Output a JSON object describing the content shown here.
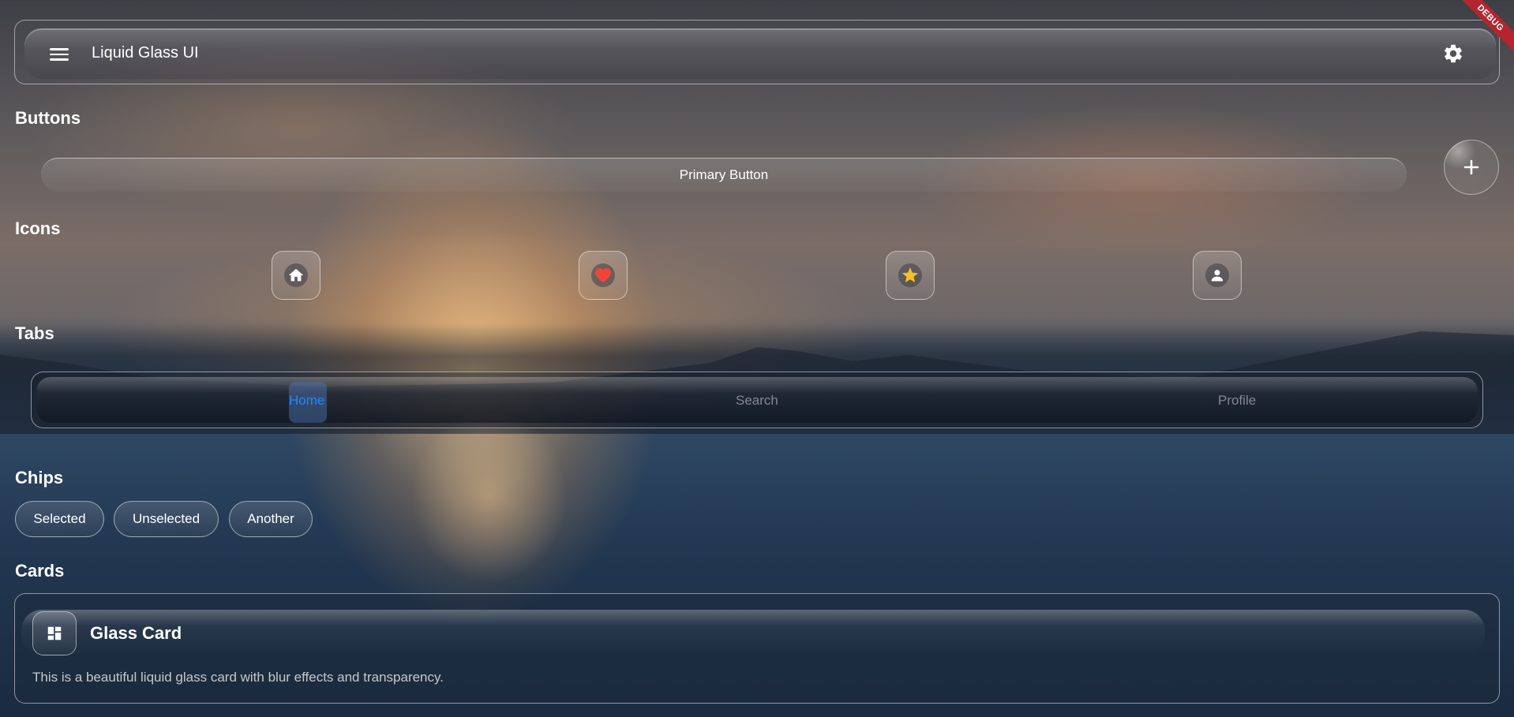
{
  "app_bar": {
    "title": "Liquid Glass UI",
    "menu_icon": "menu-icon",
    "settings_icon": "gear-icon"
  },
  "debug_banner": "DEBUG",
  "sections": {
    "buttons": "Buttons",
    "icons": "Icons",
    "tabs": "Tabs",
    "chips": "Chips",
    "cards": "Cards"
  },
  "buttons": {
    "primary_label": "Primary Button",
    "fab_icon": "plus-icon"
  },
  "icons": [
    {
      "name": "home-icon",
      "color": "#ffffff"
    },
    {
      "name": "heart-icon",
      "color": "#f04438"
    },
    {
      "name": "star-icon",
      "color": "#f6c026"
    },
    {
      "name": "person-icon",
      "color": "#ffffff"
    }
  ],
  "tabs": {
    "items": [
      {
        "label": "Home"
      },
      {
        "label": "Search"
      },
      {
        "label": "Profile"
      }
    ],
    "active_color": "#1e88ff"
  },
  "chips": [
    {
      "label": "Selected"
    },
    {
      "label": "Unselected"
    },
    {
      "label": "Another"
    }
  ],
  "card": {
    "icon": "dashboard-icon",
    "title": "Glass Card",
    "body": "This is a beautiful liquid glass card with blur effects and transparency."
  }
}
